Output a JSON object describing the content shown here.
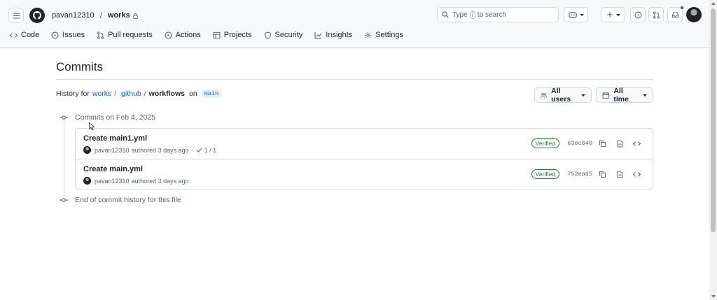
{
  "header": {
    "owner": "pavan12310",
    "separator": "/",
    "repo": "works",
    "search_placeholder_prefix": "Type",
    "search_shortcut": "/",
    "search_placeholder_suffix": "to search"
  },
  "nav": {
    "items": [
      {
        "label": "Code",
        "icon": "code-icon"
      },
      {
        "label": "Issues",
        "icon": "issue-icon"
      },
      {
        "label": "Pull requests",
        "icon": "pull-request-icon"
      },
      {
        "label": "Actions",
        "icon": "play-icon"
      },
      {
        "label": "Projects",
        "icon": "table-icon"
      },
      {
        "label": "Security",
        "icon": "shield-icon"
      },
      {
        "label": "Insights",
        "icon": "graph-icon"
      },
      {
        "label": "Settings",
        "icon": "gear-icon"
      }
    ]
  },
  "page": {
    "title": "Commits",
    "history_prefix": "History for",
    "path": [
      "works",
      ".github",
      "workflows"
    ],
    "on_label": "on",
    "branch": "main",
    "filter_users": "All users",
    "filter_time": "All time"
  },
  "timeline": {
    "group_label": "Commits on Feb 4, 2025",
    "end_label": "End of commit history for this file",
    "commits": [
      {
        "title": "Create main1.yml",
        "author": "pavan12310",
        "meta": "authored 3 days ago",
        "checks": "1 / 1",
        "verified": "Verified",
        "sha": "63ec640"
      },
      {
        "title": "Create main.yml",
        "author": "pavan12310",
        "meta": "authored 3 days ago",
        "checks": "",
        "verified": "Verified",
        "sha": "752ead5"
      }
    ]
  },
  "colors": {
    "link": "#0969da",
    "verified": "#1a7f37",
    "border": "#d1d9e0",
    "text": "#1f2328",
    "muted": "#59636e"
  }
}
